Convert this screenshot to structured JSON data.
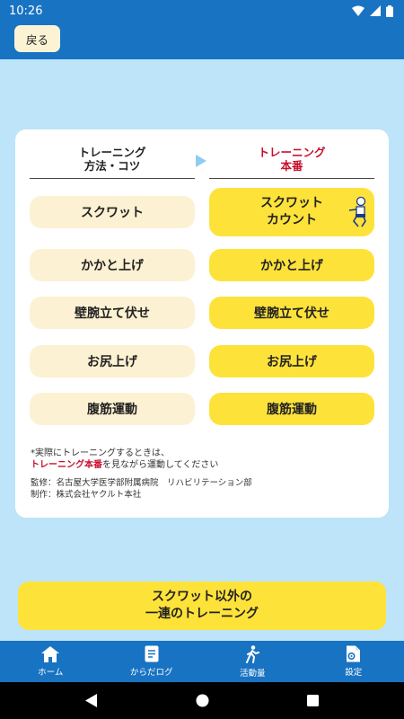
{
  "status_bar": {
    "time": "10:26"
  },
  "header": {
    "back_label": "戻る"
  },
  "columns": {
    "left_title": "トレーニング\n方法・コツ",
    "right_title": "トレーニング\n本番"
  },
  "rows": [
    {
      "left": "スクワット",
      "right": "スクワット\nカウント"
    },
    {
      "left": "かかと上げ",
      "right": "かかと上げ"
    },
    {
      "left": "壁腕立て伏せ",
      "right": "壁腕立て伏せ"
    },
    {
      "left": "お尻上げ",
      "right": "お尻上げ"
    },
    {
      "left": "腹筋運動",
      "right": "腹筋運動"
    }
  ],
  "note": {
    "line1": "*実際にトレーニングするときは、",
    "highlight": "トレーニング本番",
    "line2_rest": "を見ながら運動してください"
  },
  "credits": {
    "supervision": "監修：名古屋大学医学部附属病院　リハビリテーション部",
    "production": "制作：株式会社ヤクルト本社"
  },
  "series_button": {
    "label": "スクワット以外の\n一連のトレーニング"
  },
  "bottom_nav": [
    {
      "label": "ホーム",
      "icon": "home-icon"
    },
    {
      "label": "からだログ",
      "icon": "document-icon"
    },
    {
      "label": "活動量",
      "icon": "walking-icon"
    },
    {
      "label": "設定",
      "icon": "settings-file-icon"
    }
  ],
  "colors": {
    "primary": "#1873c2",
    "accent_yellow": "#fde23a",
    "light_pill": "#fcf1d2",
    "background": "#bde4f8",
    "highlight_red": "#c8102e"
  }
}
